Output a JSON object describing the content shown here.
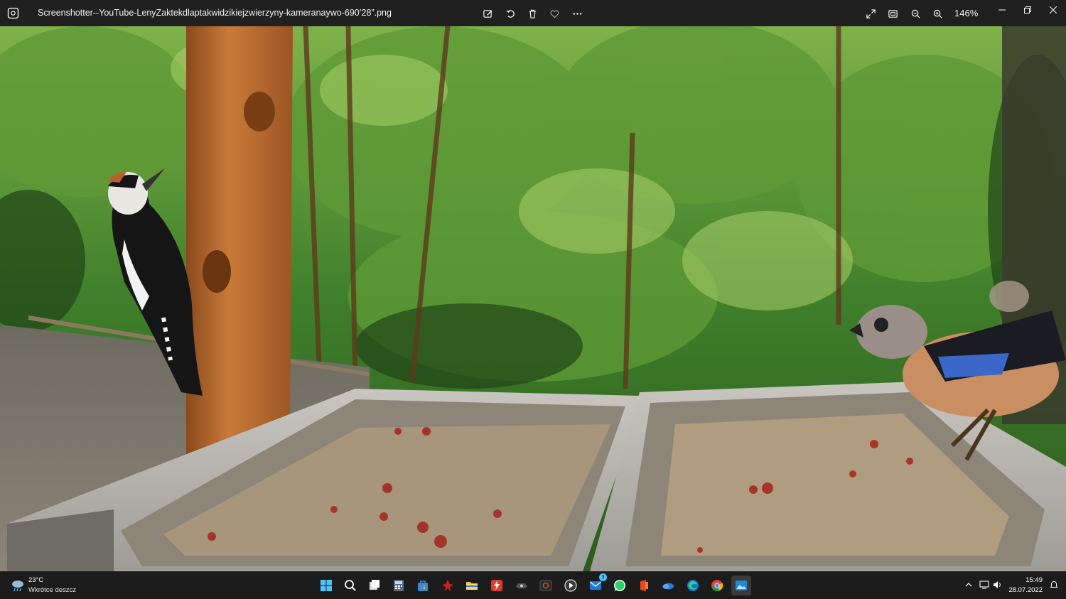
{
  "window": {
    "title": "Screenshotter--YouTube-LenyZaktekdlaptakwidzikiejzwierzyny-kameranaywo-690’28”.png",
    "zoom_level": "146%",
    "toolbar": [
      "edit-icon",
      "rotate-icon",
      "delete-icon",
      "favorite-icon",
      "more-icon"
    ],
    "view_controls": [
      "fullscreen-icon",
      "fit-icon",
      "zoom-out-icon",
      "zoom-in-icon"
    ]
  },
  "taskbar": {
    "weather": {
      "temperature": "23°C",
      "condition": "Wkrótce deszcz",
      "icon": "rain-cloud-icon"
    },
    "apps": [
      {
        "name": "start",
        "icon": "windows-icon"
      },
      {
        "name": "search",
        "icon": "search-icon"
      },
      {
        "name": "task-view",
        "icon": "task-view-icon"
      },
      {
        "name": "calculator",
        "icon": "calculator-icon"
      },
      {
        "name": "store",
        "icon": "store-icon"
      },
      {
        "name": "app-red",
        "icon": "red-app-icon"
      },
      {
        "name": "file-explorer",
        "icon": "folder-icon"
      },
      {
        "name": "app-lightning",
        "icon": "lightning-app-icon"
      },
      {
        "name": "app-capture",
        "icon": "capture-icon"
      },
      {
        "name": "app-dark",
        "icon": "dark-app-icon"
      },
      {
        "name": "media-player",
        "icon": "play-icon"
      },
      {
        "name": "mail",
        "icon": "mail-icon",
        "badge": "3"
      },
      {
        "name": "whatsapp",
        "icon": "whatsapp-icon"
      },
      {
        "name": "office",
        "icon": "office-icon"
      },
      {
        "name": "onedrive",
        "icon": "cloud-app-icon"
      },
      {
        "name": "edge",
        "icon": "edge-icon"
      },
      {
        "name": "chrome",
        "icon": "chrome-icon"
      },
      {
        "name": "photos",
        "icon": "photos-icon"
      }
    ],
    "tray": [
      "chevron-up-icon",
      "display-icon",
      "volume-icon"
    ],
    "clock": {
      "time": "15:49",
      "date": "28.07.2022"
    }
  },
  "colors": {
    "titlebar": "#202020",
    "taskbar": "#1c1c1c",
    "accent": "#4cc2ff"
  }
}
